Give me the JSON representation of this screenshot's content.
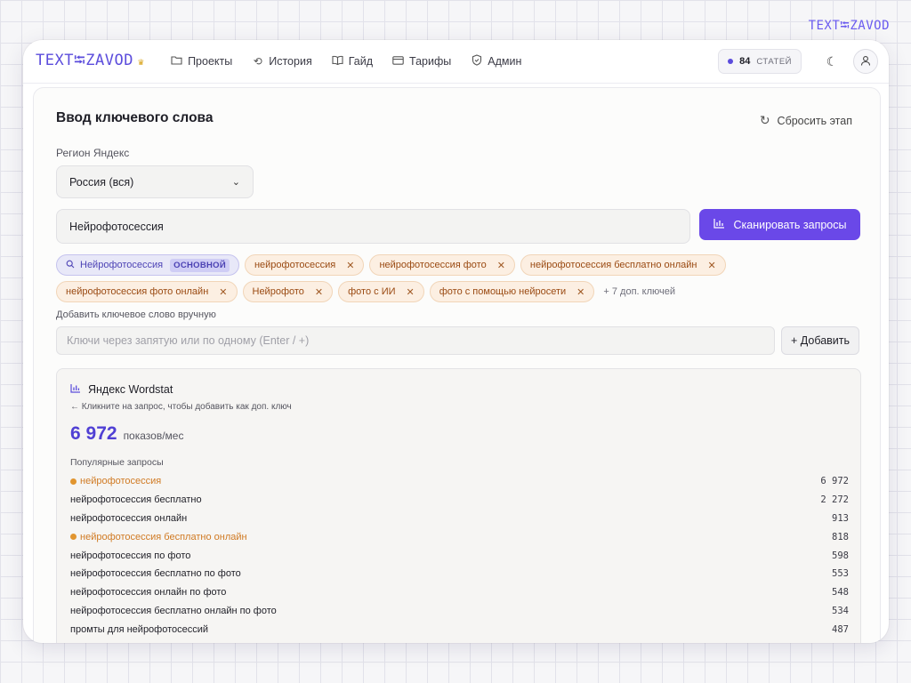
{
  "corner_logo": "TEXT⭾ZAVOD",
  "header": {
    "logo_text": "TEXT⭾ZAVOD",
    "nav": [
      {
        "label": "Проекты",
        "icon": "folder-icon"
      },
      {
        "label": "История",
        "icon": "history-icon"
      },
      {
        "label": "Гайд",
        "icon": "book-icon"
      },
      {
        "label": "Тарифы",
        "icon": "card-icon"
      },
      {
        "label": "Админ",
        "icon": "shield-icon"
      }
    ],
    "credits_count": "84",
    "credits_label": "СТАТЕЙ"
  },
  "panel": {
    "title": "Ввод ключевого слова",
    "reset_label": "Сбросить этап",
    "region_label": "Регион Яндекс",
    "region_value": "Россия (вся)",
    "keyword_value": "Нейрофотосессия",
    "scan_label": "Сканировать запросы",
    "primary_tag": {
      "label": "Нейрофотосессия",
      "badge": "ОСНОВНОЙ"
    },
    "tags_row1": [
      "нейрофотосессия",
      "нейрофотосессия фото",
      "нейрофотосессия бесплатно онлайн"
    ],
    "tags_row2": [
      "нейрофотосессия фото онлайн",
      "Нейрофото",
      "фото с ИИ",
      "фото с помощью нейросети"
    ],
    "more_keys": "+ 7 доп. ключей",
    "manual_label": "Добавить ключевое слово вручную",
    "manual_placeholder": "Ключи через запятую или по одному (Enter / +)",
    "add_label": "+ Добавить"
  },
  "wordstat": {
    "title": "Яндекс Wordstat",
    "hint": "← Кликните на запрос, чтобы добавить как доп. ключ",
    "total": "6 972",
    "total_unit": "показов/мес",
    "popular_label": "Популярные запросы",
    "rows": [
      {
        "query": "нейрофотосессия",
        "count": "6 972",
        "selected": true
      },
      {
        "query": "нейрофотосессия бесплатно",
        "count": "2 272",
        "selected": false
      },
      {
        "query": "нейрофотосессия онлайн",
        "count": "913",
        "selected": false
      },
      {
        "query": "нейрофотосессия бесплатно онлайн",
        "count": "818",
        "selected": true
      },
      {
        "query": "нейрофотосессия по фото",
        "count": "598",
        "selected": false
      },
      {
        "query": "нейрофотосессия бесплатно по фото",
        "count": "553",
        "selected": false
      },
      {
        "query": "нейрофотосессия онлайн по фото",
        "count": "548",
        "selected": false
      },
      {
        "query": "нейрофотосессия бесплатно онлайн по фото",
        "count": "534",
        "selected": false
      },
      {
        "query": "промты для нейрофотосессий",
        "count": "487",
        "selected": false
      }
    ]
  }
}
